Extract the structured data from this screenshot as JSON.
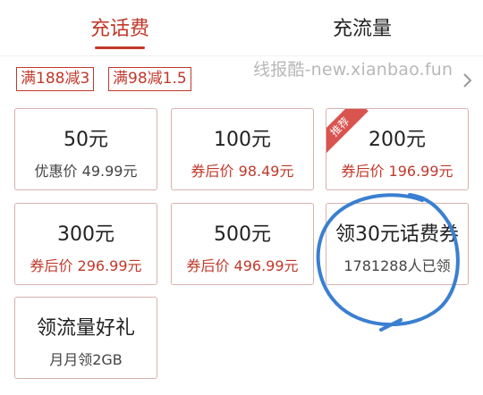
{
  "tabs": [
    {
      "label": "充话费"
    },
    {
      "label": "充流量"
    }
  ],
  "coupons": [
    "满188减3",
    "满98减1.5"
  ],
  "watermark": "线报酷-new.xianbao.fun",
  "cards": [
    {
      "title": "50元",
      "sub": "优惠价 49.99元"
    },
    {
      "title": "100元",
      "sub": "券后价 98.49元"
    },
    {
      "title": "200元",
      "sub": "券后价 196.99元",
      "badge": "推荐"
    },
    {
      "title": "300元",
      "sub": "券后价 296.99元"
    },
    {
      "title": "500元",
      "sub": "券后价 496.99元"
    },
    {
      "title": "领30元话费券",
      "sub": "1781288人已领"
    },
    {
      "title": "领流量好礼",
      "sub": "月月领2GB"
    }
  ],
  "colors": {
    "accent": "#c0392b",
    "annotation": "#3a7fd1"
  }
}
